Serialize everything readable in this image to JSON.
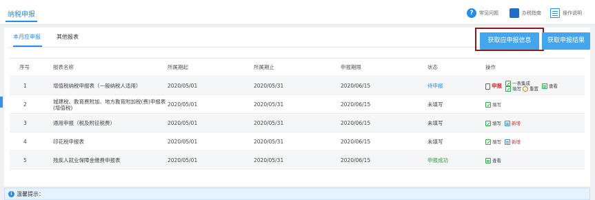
{
  "header": {
    "title": "纳税申报",
    "links": [
      {
        "label": "常见问题",
        "icon": "question-icon"
      },
      {
        "label": "办税指南",
        "icon": "guide-book-icon"
      },
      {
        "label": "操作说明",
        "icon": "document-icon"
      }
    ]
  },
  "tabs": [
    {
      "label": "本月应申报",
      "active": true
    },
    {
      "label": "其他报表",
      "active": false
    }
  ],
  "buttons": {
    "fetch_info": "获取应申报信息",
    "fetch_result": "获取申报结果"
  },
  "table": {
    "headers": [
      "序号",
      "报表名称",
      "所属期起",
      "所属期止",
      "申报期限",
      "状态",
      "操作"
    ],
    "rows": [
      {
        "no": "1",
        "name": "增值税纳税申报表（一般纳税人适用）",
        "start": "2020/05/01",
        "end": "2020/05/31",
        "deadline": "2020/06/15",
        "status": "待申报"
      },
      {
        "no": "2",
        "name": "城建税、教育费附加、地方教育附加税(费)申报表(增值税)",
        "start": "2020/05/01",
        "end": "2020/05/31",
        "deadline": "2020/06/15",
        "status": "未填写"
      },
      {
        "no": "3",
        "name": "通用申报（税及附征税费）",
        "start": "2020/05/01",
        "end": "2020/05/31",
        "deadline": "2020/06/15",
        "status": "未填写"
      },
      {
        "no": "4",
        "name": "印花税申报表",
        "start": "2020/05/01",
        "end": "2020/05/31",
        "deadline": "2020/06/15",
        "status": "未填写"
      },
      {
        "no": "5",
        "name": "残疾人就业保障金缴费申报表",
        "start": "2020/05/01",
        "end": "2020/05/31",
        "deadline": "2020/06/15",
        "status": "申报成功"
      }
    ],
    "ops": {
      "declare": "申报",
      "one_table": "一表集成",
      "fill": "填写",
      "reset": "重置",
      "view": "查看",
      "add": "新增"
    }
  },
  "tips": {
    "title": "温馨提示："
  },
  "colors": {
    "accent": "#2a8be6",
    "button": "#43a5ee",
    "success": "#2d9e3b",
    "danger": "#d9262a",
    "highlight_border": "#8b1b1b"
  }
}
